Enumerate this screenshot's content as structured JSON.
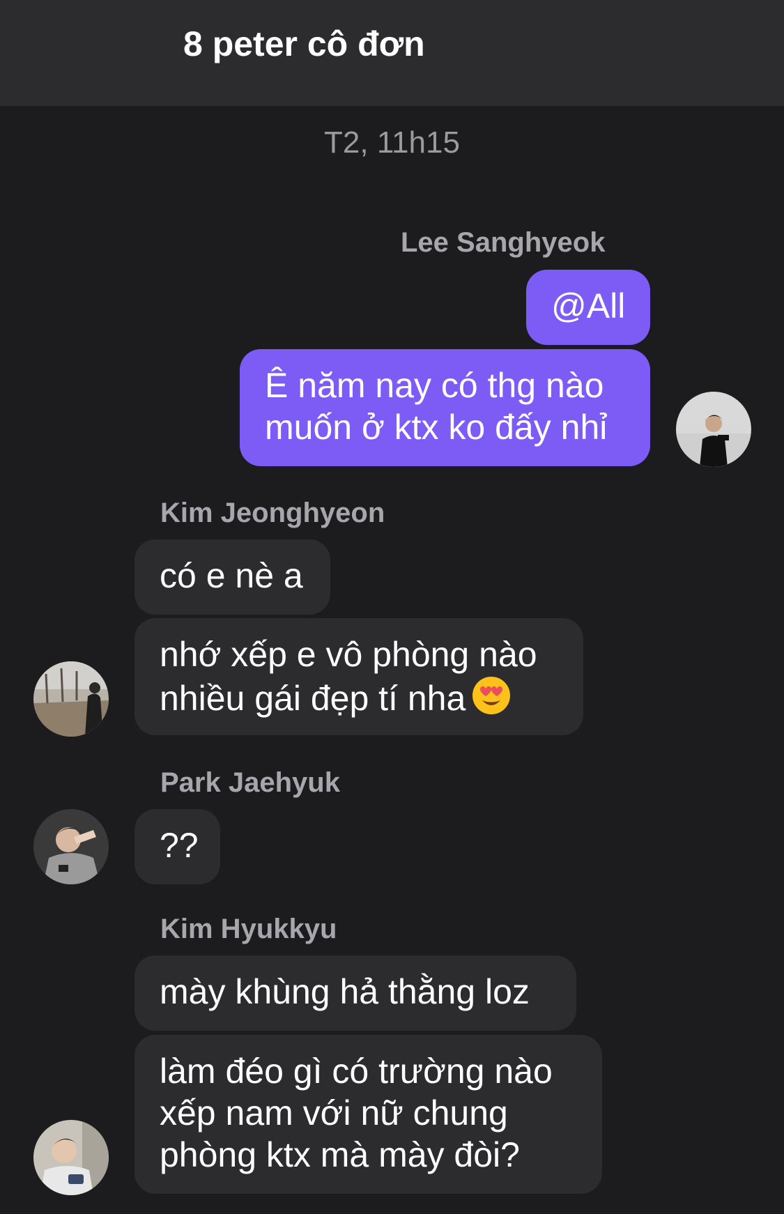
{
  "header": {
    "title": "8 peter cô đơn"
  },
  "timestamp": "T2, 11h15",
  "messages": [
    {
      "sender": "Lee Sanghyeok",
      "avatar_icon": "avatar-lee-sanghyeok",
      "bubbles": [
        "@All",
        "Ê năm nay có thg nào",
        "muốn ở ktx ko đấy nhỉ"
      ]
    },
    {
      "sender": "Kim Jeonghyeon",
      "avatar_icon": "avatar-kim-jeonghyeon",
      "bubbles": [
        "có e nè a",
        "nhớ xếp e vô phòng nào",
        "nhiều gái đẹp tí nha"
      ],
      "emoji": "heart-eyes-emoji"
    },
    {
      "sender": "Park Jaehyuk",
      "avatar_icon": "avatar-park-jaehyuk",
      "bubbles": [
        "??"
      ]
    },
    {
      "sender": "Kim Hyukkyu",
      "avatar_icon": "avatar-kim-hyukkyu",
      "bubbles": [
        "mày khùng hả thằng loz",
        "làm đéo gì có trường nào",
        "xếp nam với nữ chung",
        "phòng ktx mà mày đòi?"
      ]
    }
  ],
  "colors": {
    "background": "#1c1c1e",
    "header": "#2c2c2e",
    "incoming_bubble": "#2c2c2e",
    "outgoing_bubble": "#7c5cf5",
    "sender_name": "#a6a6ac"
  }
}
